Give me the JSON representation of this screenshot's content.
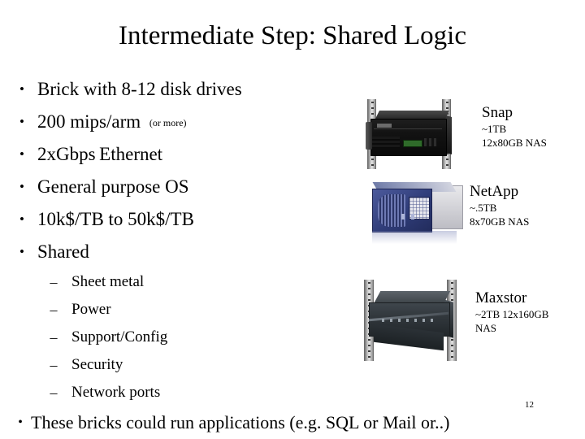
{
  "slide": {
    "title": "Intermediate Step: Shared Logic",
    "page_number": "12"
  },
  "bullets": [
    {
      "marker": "•",
      "text": "Brick with 8-12 disk drives",
      "note": ""
    },
    {
      "marker": "•",
      "text": "200 mips/arm",
      "note": "(or more)"
    },
    {
      "marker": "•",
      "text": "2xGbps Ethernet",
      "note": ""
    },
    {
      "marker": "•",
      "text": "General purpose OS",
      "note": ""
    },
    {
      "marker": "•",
      "text": "10k$/TB to 50k$/TB",
      "note": ""
    },
    {
      "marker": "•",
      "text": "Shared",
      "note": ""
    }
  ],
  "subbullets": [
    {
      "marker": "–",
      "text": "Sheet metal"
    },
    {
      "marker": "–",
      "text": "Power"
    },
    {
      "marker": "–",
      "text": "Support/Config"
    },
    {
      "marker": "–",
      "text": "Security"
    },
    {
      "marker": "–",
      "text": "Network ports"
    }
  ],
  "bottom": {
    "marker": "•",
    "text": "These bricks could run applications (e.g. SQL or Mail or..)"
  },
  "products": [
    {
      "brand": "Snap",
      "capacity": "~1TB",
      "config": "12x80GB NAS",
      "image_name": "snap-rack-server-photo",
      "colors": {
        "chassis": "#121212",
        "rail": "#c9c9c9",
        "lcd": "#2f6b2a"
      }
    },
    {
      "brand": "NetApp",
      "capacity": "~.5TB",
      "config": "8x70GB NAS",
      "image_name": "netapp-filer-photo",
      "colors": {
        "bezel": "#2f3c78",
        "body": "#d3d5e0"
      }
    },
    {
      "brand": "Maxstor",
      "capacity": "~2TB  12x160GB",
      "config": "NAS",
      "image_name": "maxstor-rack-unit-photo",
      "colors": {
        "chassis": "#30363b",
        "rail": "#c9c9c9"
      }
    }
  ]
}
